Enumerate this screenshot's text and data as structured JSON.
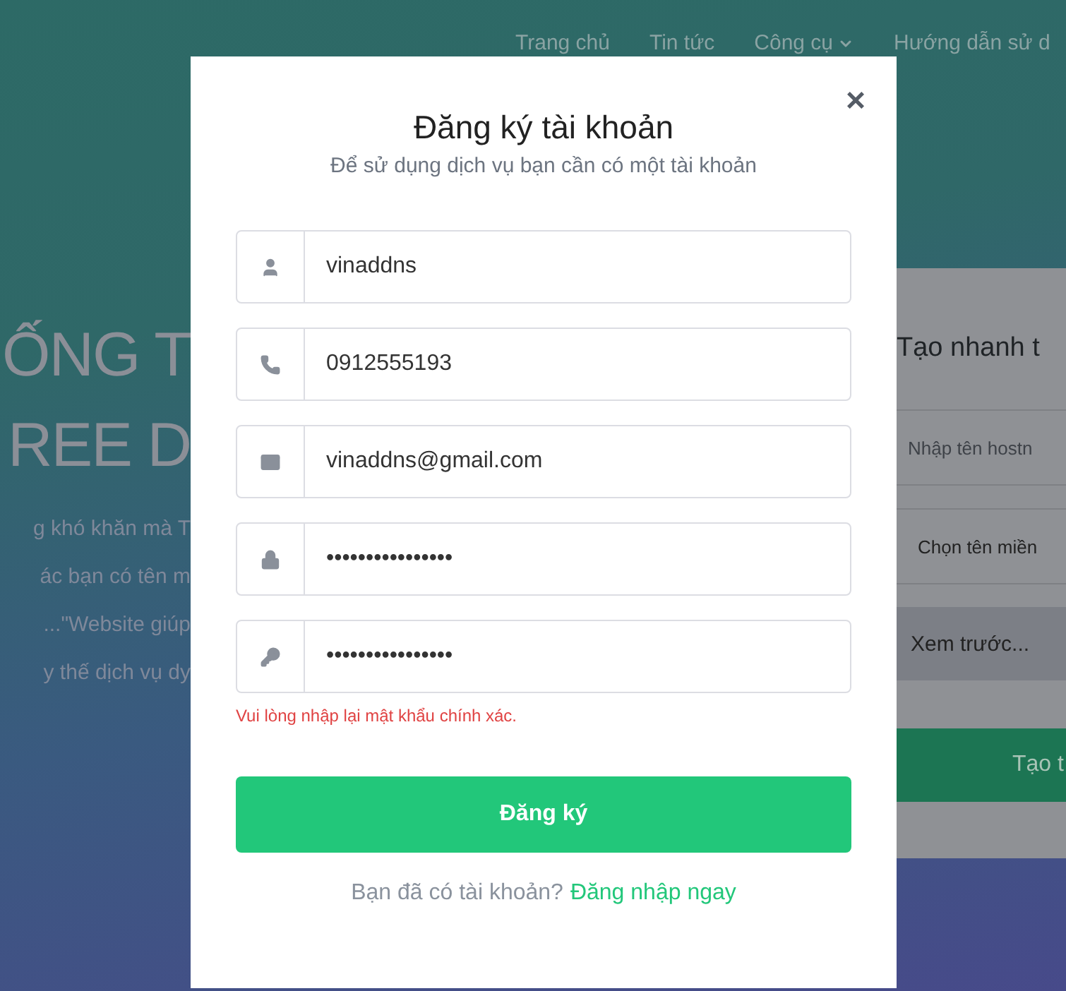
{
  "nav": [
    {
      "label": "Trang chủ",
      "dropdown": false
    },
    {
      "label": "Tin tức",
      "dropdown": false
    },
    {
      "label": "Công cụ",
      "dropdown": true
    },
    {
      "label": "Hướng dẫn sử d",
      "dropdown": false
    }
  ],
  "hero": {
    "headline": [
      "ỐNG T",
      "REE D"
    ],
    "lines": [
      "g khó khăn mà T",
      "ác bạn có tên m",
      "...\"Website giúp",
      "y thế dịch vụ dy"
    ]
  },
  "quick_card": {
    "title": "Tạo nhanh t",
    "hostname_placeholder": "Nhập tên hostn",
    "domain_select": "Chọn tên miền",
    "preview": "Xem trước...",
    "create_button": "Tạo t"
  },
  "modal": {
    "title": "Đăng ký tài khoản",
    "subtitle": "Để sử dụng dịch vụ bạn cần có một tài khoản",
    "close": "×",
    "fields": [
      {
        "value": "vinaddns"
      },
      {
        "value": "0912555193"
      },
      {
        "value": "vinaddns@gmail.com"
      },
      {
        "value": "••••••••••••••••"
      },
      {
        "value": "••••••••••••••••"
      }
    ],
    "error": "Vui lòng nhập lại mật khẩu chính xác.",
    "submit": "Đăng ký",
    "footer_text": "Bạn đã có tài khoản?",
    "footer_link": "Đăng nhập ngay"
  }
}
